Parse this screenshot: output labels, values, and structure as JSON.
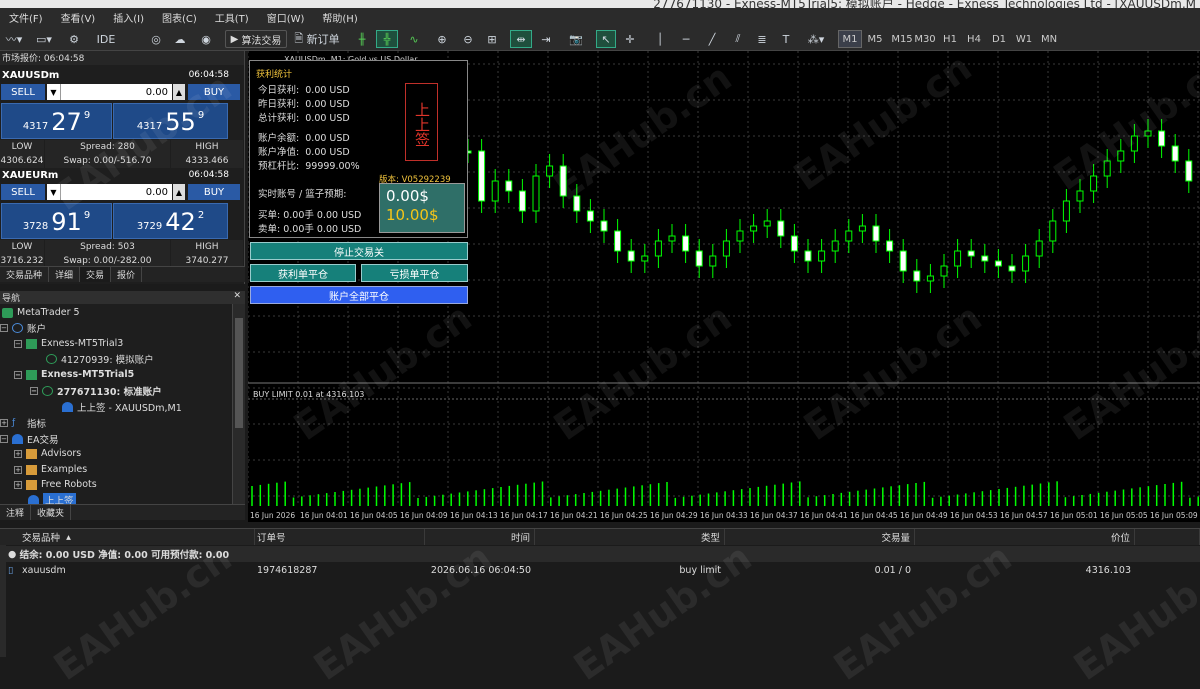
{
  "window": {
    "title": "277671130 - Exness-MT5Trial5: 模拟账户 - Hedge - Exness Technologies Ltd - [XAUUSDm,M"
  },
  "menu": [
    "文件(F)",
    "查看(V)",
    "插入(I)",
    "图表(C)",
    "工具(T)",
    "窗口(W)",
    "帮助(H)"
  ],
  "toolbar": {
    "ide": "IDE",
    "algo": "算法交易",
    "neworder": "新订单",
    "timeframes": [
      "M1",
      "M5",
      "M15",
      "M30",
      "H1",
      "H4",
      "D1",
      "W1",
      "MN"
    ],
    "active_tf": "M1"
  },
  "market_watch": {
    "header": "市场报价: 06:04:58",
    "symbols": [
      {
        "name": "XAUUSDm",
        "time": "06:04:58",
        "sell": "SELL",
        "buy": "BUY",
        "lot": "0.00",
        "bid_small": "4317",
        "bid_big": "27",
        "bid_sup": "9",
        "ask_small": "4317",
        "ask_big": "55",
        "ask_sup": "9",
        "low_label": "LOW",
        "low": "4306.624",
        "spread": "Spread: 280",
        "swap": "Swap: 0.00/-516.70",
        "high_label": "HIGH",
        "high": "4333.466"
      },
      {
        "name": "XAUEURm",
        "time": "06:04:58",
        "sell": "SELL",
        "buy": "BUY",
        "lot": "0.00",
        "bid_small": "3728",
        "bid_big": "91",
        "bid_sup": "9",
        "ask_small": "3729",
        "ask_big": "42",
        "ask_sup": "2",
        "low_label": "LOW",
        "low": "3716.232",
        "spread": "Spread: 503",
        "swap": "Swap: 0.00/-282.00",
        "high_label": "HIGH",
        "high": "3740.277"
      }
    ],
    "tabs": [
      "交易品种",
      "详细",
      "交易",
      "报价"
    ]
  },
  "navigator": {
    "header": "导航",
    "items": [
      "MetaTrader 5",
      "账户",
      "Exness-MT5Trial3",
      "41270939: 模拟账户",
      "Exness-MT5Trial5",
      "277671130: 标准账户",
      "上上签 - XAUUSDm,M1",
      "指标",
      "EA交易",
      "Advisors",
      "Examples",
      "Free Robots",
      "上上签"
    ],
    "tabs": [
      "注释",
      "收藏夹"
    ]
  },
  "chart": {
    "symbol_label": "XAUUSDm, M1: Gold vs US Dollar",
    "order_line": "BUY LIMIT 0.01 at 4316.103",
    "time_labels": [
      "16 Jun 2026",
      "16 Jun 04:01",
      "16 Jun 04:05",
      "16 Jun 04:09",
      "16 Jun 04:13",
      "16 Jun 04:17",
      "16 Jun 04:21",
      "16 Jun 04:25",
      "16 Jun 04:29",
      "16 Jun 04:33",
      "16 Jun 04:37",
      "16 Jun 04:41",
      "16 Jun 04:45",
      "16 Jun 04:49",
      "16 Jun 04:53",
      "16 Jun 04:57",
      "16 Jun 05:01",
      "16 Jun 05:05",
      "16 Jun 05:09"
    ],
    "up_color": "#00ff00",
    "down_color": "#ffffff"
  },
  "ea_panel": {
    "title": "获利统计",
    "rows": [
      {
        "k": "今日获利:",
        "v": "0.00 USD"
      },
      {
        "k": "昨日获利:",
        "v": "0.00 USD"
      },
      {
        "k": "总计获利:",
        "v": "0.00 USD"
      }
    ],
    "rows2": [
      {
        "k": "账户余额:",
        "v": "0.00 USD"
      },
      {
        "k": "账户净值:",
        "v": "0.00 USD"
      },
      {
        "k": "预杠杆比:",
        "v": "99999.00%"
      }
    ],
    "stamp": "上上签",
    "version": "版本: V05292239",
    "realtime": "实时账号 / 篮子预期:",
    "val1": "0.00$",
    "val2": "10.00$",
    "buy_row": "买单: 0.00手   0.00 USD",
    "sell_row": "卖单: 0.00手   0.00 USD",
    "btn_stop": "停止交易关",
    "btn_profit": "获利单平仓",
    "btn_loss": "亏损单平仓",
    "btn_all": "账户全部平仓"
  },
  "trade_table": {
    "headers": [
      "交易品种",
      "订单号",
      "时间",
      "类型",
      "交易量",
      "价位"
    ],
    "summary": "结余: 0.00 USD  净值: 0.00  可用预付款: 0.00",
    "rows": [
      {
        "symbol": "xauusdm",
        "order": "1974618287",
        "time": "2026.06.16 06:04:50",
        "type": "buy limit",
        "volume": "0.01 / 0",
        "price": "4316.103"
      }
    ]
  },
  "watermark": "EAHub.cn"
}
